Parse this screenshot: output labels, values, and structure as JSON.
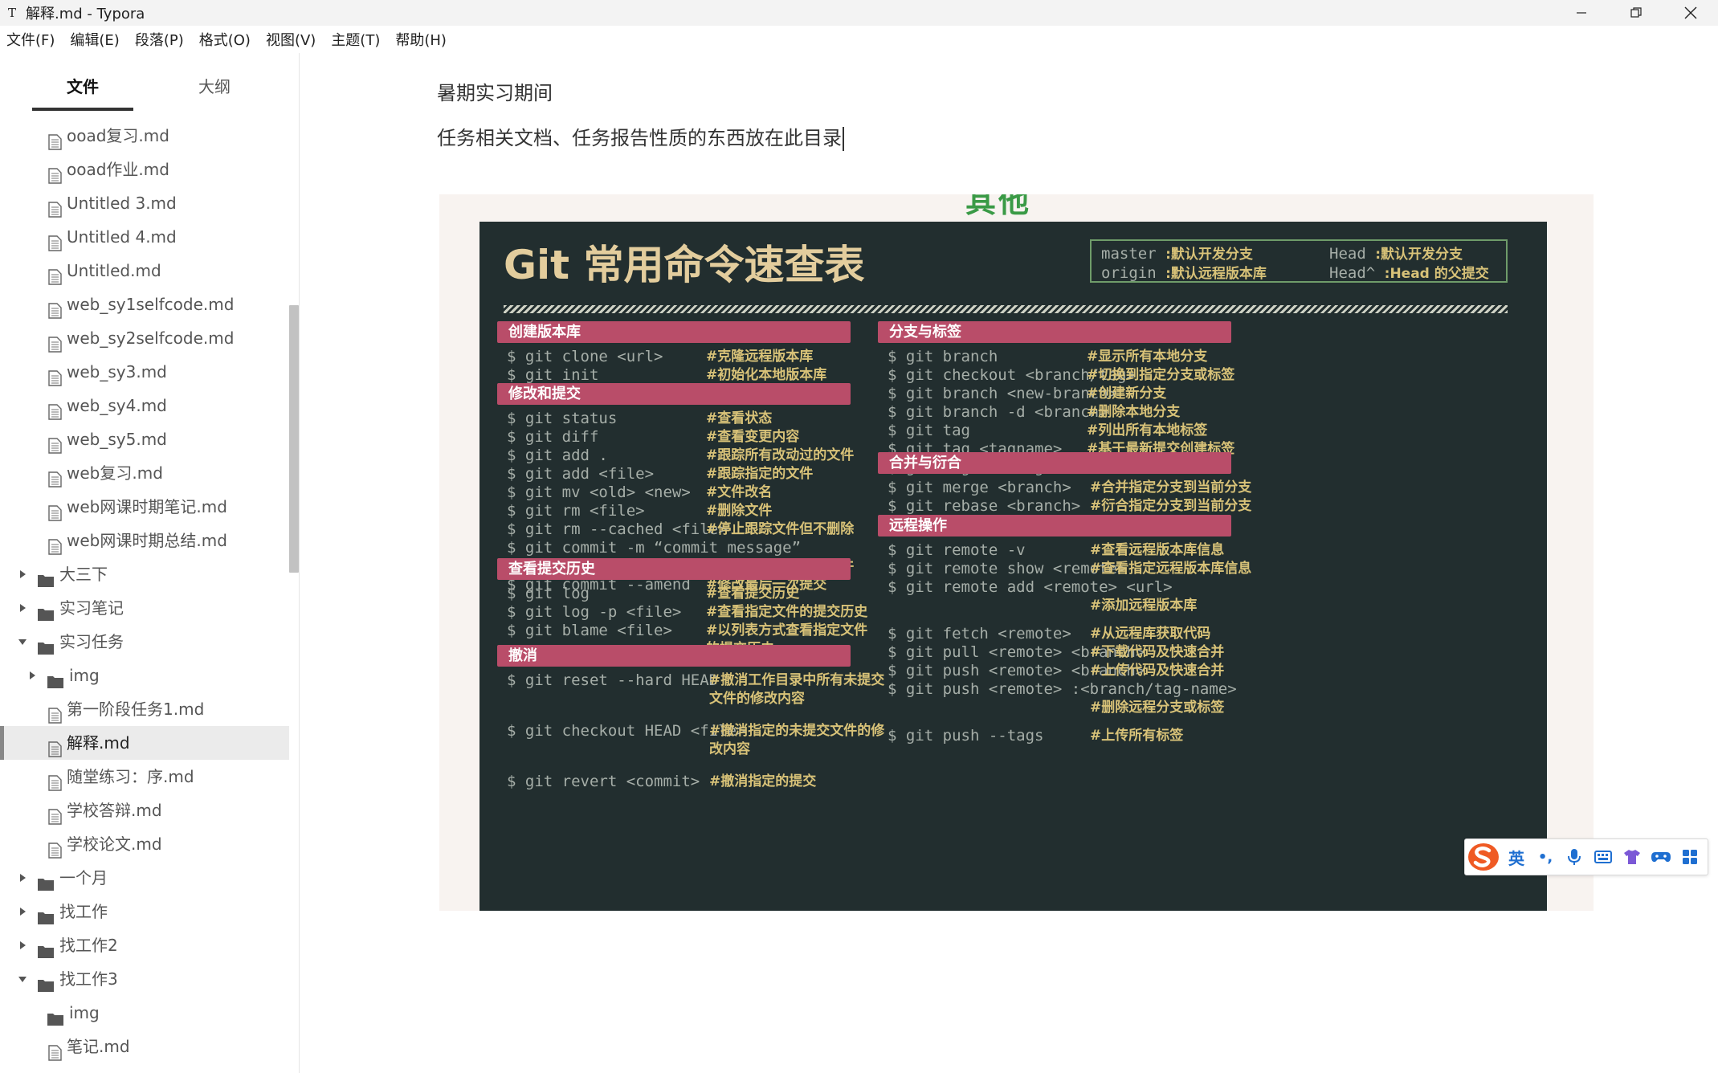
{
  "window": {
    "app_icon": "T",
    "title": "解释.md - Typora"
  },
  "menu": [
    "文件(F)",
    "编辑(E)",
    "段落(P)",
    "格式(O)",
    "视图(V)",
    "主题(T)",
    "帮助(H)"
  ],
  "sidebar": {
    "tabs": [
      "文件",
      "大纲"
    ],
    "active_tab": 0,
    "tree": [
      {
        "label": "ooad复习.md",
        "type": "file",
        "level": 1
      },
      {
        "label": "ooad作业.md",
        "type": "file",
        "level": 1
      },
      {
        "label": "Untitled 3.md",
        "type": "file",
        "level": 1
      },
      {
        "label": "Untitled 4.md",
        "type": "file",
        "level": 1
      },
      {
        "label": "Untitled.md",
        "type": "file",
        "level": 1
      },
      {
        "label": "web_sy1selfcode.md",
        "type": "file",
        "level": 1
      },
      {
        "label": "web_sy2selfcode.md",
        "type": "file",
        "level": 1
      },
      {
        "label": "web_sy3.md",
        "type": "file",
        "level": 1
      },
      {
        "label": "web_sy4.md",
        "type": "file",
        "level": 1
      },
      {
        "label": "web_sy5.md",
        "type": "file",
        "level": 1
      },
      {
        "label": "web复习.md",
        "type": "file",
        "level": 1
      },
      {
        "label": "web网课时期笔记.md",
        "type": "file",
        "level": 1
      },
      {
        "label": "web网课时期总结.md",
        "type": "file",
        "level": 1
      },
      {
        "label": "大三下",
        "type": "folder",
        "level": 0,
        "state": "collapsed"
      },
      {
        "label": "实习笔记",
        "type": "folder",
        "level": 0,
        "state": "collapsed"
      },
      {
        "label": "实习任务",
        "type": "folder",
        "level": 0,
        "state": "expanded"
      },
      {
        "label": "img",
        "type": "folder",
        "level": 1,
        "state": "collapsed"
      },
      {
        "label": "第一阶段任务1.md",
        "type": "file",
        "level": 1
      },
      {
        "label": "解释.md",
        "type": "file",
        "level": 1,
        "active": true
      },
      {
        "label": "随堂练习：序.md",
        "type": "file",
        "level": 1
      },
      {
        "label": "学校答辩.md",
        "type": "file",
        "level": 1
      },
      {
        "label": "学校论文.md",
        "type": "file",
        "level": 1
      },
      {
        "label": "一个月",
        "type": "folder",
        "level": 0,
        "state": "collapsed"
      },
      {
        "label": "找工作",
        "type": "folder",
        "level": 0,
        "state": "collapsed"
      },
      {
        "label": "找工作2",
        "type": "folder",
        "level": 0,
        "state": "collapsed"
      },
      {
        "label": "找工作3",
        "type": "folder",
        "level": 0,
        "state": "expanded"
      },
      {
        "label": "img",
        "type": "folder",
        "level": 1,
        "state": "none"
      },
      {
        "label": "笔记.md",
        "type": "file",
        "level": 1
      }
    ]
  },
  "editor": {
    "paragraphs": [
      "暑期实习期间",
      "任务相关文档、任务报告性质的东西放在此目录"
    ]
  },
  "cheatsheet": {
    "peek": "其他",
    "title": "Git 常用命令速查表",
    "refs": [
      {
        "cmd": "master ",
        "desc": ":默认开发分支"
      },
      {
        "cmd": "Head ",
        "desc": ":默认开发分支"
      },
      {
        "cmd": "origin ",
        "desc": ":默认远程版本库"
      },
      {
        "cmd": "Head^ ",
        "desc": ":Head 的父提交"
      }
    ],
    "sections": {
      "create": {
        "title": "创建版本库",
        "items": [
          {
            "cmd": "$ git clone <url>",
            "note": "#克隆远程版本库"
          },
          {
            "cmd": "$ git init",
            "note": "#初始化本地版本库"
          }
        ]
      },
      "modify": {
        "title": "修改和提交",
        "items": [
          {
            "cmd": "$ git status",
            "note": "#查看状态"
          },
          {
            "cmd": "$ git diff",
            "note": "#查看变更内容"
          },
          {
            "cmd": "$ git add .",
            "note": "#跟踪所有改动过的文件"
          },
          {
            "cmd": "$ git add <file>",
            "note": "#跟踪指定的文件"
          },
          {
            "cmd": "$ git mv <old> <new>",
            "note": "#文件改名"
          },
          {
            "cmd": "$ git rm <file>",
            "note": "#删除文件"
          },
          {
            "cmd": "$ git rm --cached <file>",
            "note": "#停止跟踪文件但不删除"
          },
          {
            "cmd": "$ git commit -m “commit message”",
            "note": ""
          },
          {
            "cmd": "",
            "note": "#提交所有更新过的文件"
          },
          {
            "cmd": "$ git commit --amend",
            "note": "#修改最后一次提交"
          }
        ]
      },
      "history": {
        "title": "查看提交历史",
        "items": [
          {
            "cmd": "$ git log",
            "note": "#查看提交历史"
          },
          {
            "cmd": "$ git log -p <file>",
            "note": "#查看指定文件的提交历史"
          },
          {
            "cmd": "$ git blame <file>",
            "note": "#以列表方式查看指定文件"
          },
          {
            "cmd": "",
            "note": "的提交历史"
          }
        ]
      },
      "undo": {
        "title": "撤消",
        "items": [
          {
            "cmd": "$ git reset --hard HEAD",
            "note": "#撤消工作目录中所有未提交"
          },
          {
            "cmd": "",
            "note": "文件的修改内容"
          },
          {
            "cmd": "$ git checkout HEAD <file>",
            "note": "#撤消指定的未提交文件的修"
          },
          {
            "cmd": "",
            "note": "改内容"
          },
          {
            "cmd": "$ git revert <commit>",
            "note": "#撤消指定的提交"
          }
        ]
      },
      "branch": {
        "title": "分支与标签",
        "items": [
          {
            "cmd": "$ git branch",
            "note": "#显示所有本地分支"
          },
          {
            "cmd": "$ git checkout <branch/tag>",
            "note": "#切换到指定分支或标签"
          },
          {
            "cmd": "$ git branch <new-branch>",
            "note": "#创建新分支"
          },
          {
            "cmd": "$ git branch -d <branch>",
            "note": "#删除本地分支"
          },
          {
            "cmd": "$ git tag",
            "note": "#列出所有本地标签"
          },
          {
            "cmd": "$ git tag <tagname>",
            "note": "#基于最新提交创建标签"
          },
          {
            "cmd": "$ git tag -d <tagname>",
            "note": "#删除标签"
          }
        ]
      },
      "merge": {
        "title": "合并与衍合",
        "items": [
          {
            "cmd": "$ git merge <branch>",
            "note": "#合并指定分支到当前分支"
          },
          {
            "cmd": "$ git rebase <branch>",
            "note": "#衍合指定分支到当前分支"
          }
        ]
      },
      "remote": {
        "title": "远程操作",
        "items": [
          {
            "cmd": "$ git remote -v",
            "note": "#查看远程版本库信息"
          },
          {
            "cmd": "$ git remote show <remote>",
            "note": "#查看指定远程版本库信息"
          },
          {
            "cmd": "$ git remote add <remote> <url>",
            "note": ""
          },
          {
            "cmd": "",
            "note": "#添加远程版本库"
          },
          {
            "cmd": "$ git fetch <remote>",
            "note": "#从远程库获取代码"
          },
          {
            "cmd": "$ git pull <remote> <branch>",
            "note": "#下载代码及快速合并"
          },
          {
            "cmd": "$ git push <remote> <branch>",
            "note": "#上传代码及快速合并"
          },
          {
            "cmd": "$ git push <remote> :<branch/tag-name>",
            "note": ""
          },
          {
            "cmd": "",
            "note": "#删除远程分支或标签"
          },
          {
            "cmd": "$ git push --tags",
            "note": "#上传所有标签"
          }
        ]
      }
    }
  },
  "ime": {
    "mode": "英",
    "punct": "•,",
    "icons": [
      "sogou-logo-icon",
      "microphone-icon",
      "keyboard-icon",
      "skin-shirt-icon",
      "game-controller-icon",
      "toolbox-grid-icon"
    ]
  },
  "colors": {
    "sheet_bg": "#222e2f",
    "section_header": "#b94d69",
    "note_text": "#d8c278",
    "title_text": "#e3cd9d",
    "command_text": "#a6aea8",
    "ime_blue": "#1f6fd1",
    "ime_orange": "#ef5a24"
  }
}
